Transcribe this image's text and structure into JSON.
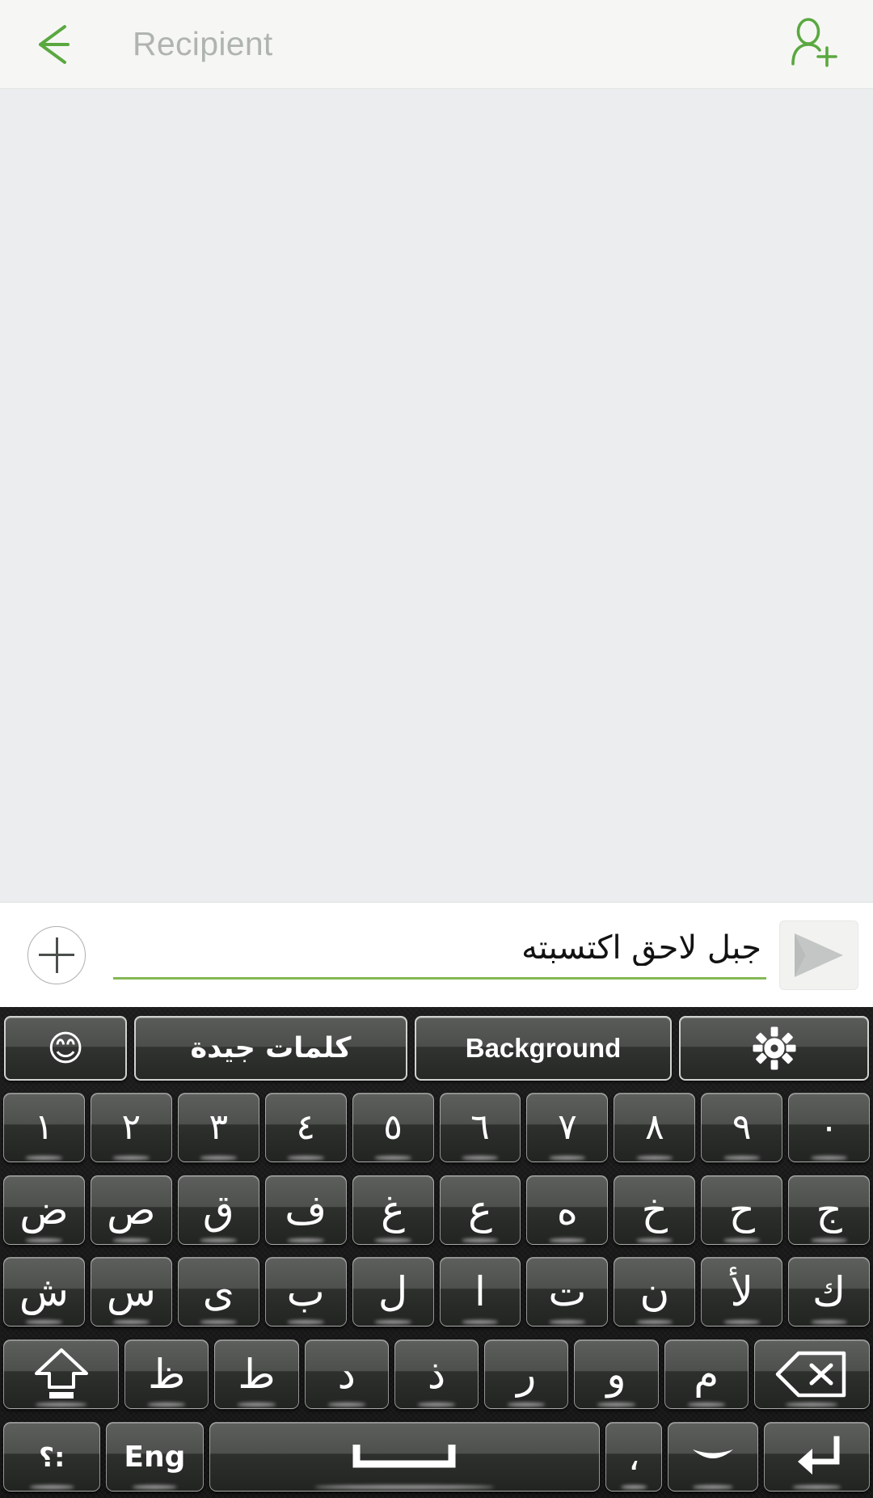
{
  "header": {
    "back_icon": "back-arrow-icon",
    "recipient_placeholder": "Recipient",
    "recipient_value": "",
    "add_contact_icon": "add-contact-icon",
    "accent_color": "#5aa840",
    "placeholder_color": "#b0b4b0",
    "background_color": "#f6f7f4"
  },
  "conversation": {
    "messages": [],
    "background_color": "#ebedee"
  },
  "compose": {
    "attach_icon": "plus-icon",
    "message_value": "جبل لاحق اكتسبته",
    "message_placeholder": "",
    "underline_color": "#84b854",
    "send_icon": "send-paper-plane-icon"
  },
  "keyboard": {
    "layout_name": "arabic",
    "toolbar": [
      {
        "name": "emoji-button",
        "label": "😊",
        "type": "emoji"
      },
      {
        "name": "good-words-button",
        "label": "كلمات جيدة",
        "type": "text"
      },
      {
        "name": "background-button",
        "label": "Background",
        "type": "text"
      },
      {
        "name": "settings-button",
        "label": "",
        "type": "gear"
      }
    ],
    "rows": [
      {
        "name": "number-row",
        "keys": [
          {
            "label": "١",
            "name": "key-1"
          },
          {
            "label": "٢",
            "name": "key-2"
          },
          {
            "label": "٣",
            "name": "key-3"
          },
          {
            "label": "٤",
            "name": "key-4"
          },
          {
            "label": "٥",
            "name": "key-5"
          },
          {
            "label": "٦",
            "name": "key-6"
          },
          {
            "label": "٧",
            "name": "key-7"
          },
          {
            "label": "٨",
            "name": "key-8"
          },
          {
            "label": "٩",
            "name": "key-9"
          },
          {
            "label": "٠",
            "name": "key-0"
          }
        ]
      },
      {
        "name": "letter-row-1",
        "keys": [
          {
            "label": "ض",
            "name": "key-dad"
          },
          {
            "label": "ص",
            "name": "key-sad"
          },
          {
            "label": "ق",
            "name": "key-qaf"
          },
          {
            "label": "ف",
            "name": "key-fa"
          },
          {
            "label": "غ",
            "name": "key-ghain"
          },
          {
            "label": "ع",
            "name": "key-ain"
          },
          {
            "label": "ه",
            "name": "key-ha"
          },
          {
            "label": "خ",
            "name": "key-kha"
          },
          {
            "label": "ح",
            "name": "key-hah"
          },
          {
            "label": "ج",
            "name": "key-jeem"
          }
        ]
      },
      {
        "name": "letter-row-2",
        "keys": [
          {
            "label": "ش",
            "name": "key-sheen"
          },
          {
            "label": "س",
            "name": "key-seen"
          },
          {
            "label": "ى",
            "name": "key-alef-maqsura"
          },
          {
            "label": "ب",
            "name": "key-ba"
          },
          {
            "label": "ل",
            "name": "key-lam"
          },
          {
            "label": "ا",
            "name": "key-alef"
          },
          {
            "label": "ت",
            "name": "key-ta"
          },
          {
            "label": "ن",
            "name": "key-noon"
          },
          {
            "label": "لأ",
            "name": "key-lam-alef-hamza"
          },
          {
            "label": "ك",
            "name": "key-kaf"
          }
        ]
      },
      {
        "name": "letter-row-3",
        "keys": [
          {
            "label": "",
            "name": "shift-key",
            "icon": "shift-arrow-icon"
          },
          {
            "label": "ظ",
            "name": "key-zah"
          },
          {
            "label": "ط",
            "name": "key-tah"
          },
          {
            "label": "د",
            "name": "key-dal"
          },
          {
            "label": "ذ",
            "name": "key-thal"
          },
          {
            "label": "ر",
            "name": "key-ra"
          },
          {
            "label": "و",
            "name": "key-waw"
          },
          {
            "label": "م",
            "name": "key-meem"
          },
          {
            "label": "",
            "name": "backspace-key",
            "icon": "backspace-icon"
          }
        ]
      },
      {
        "name": "bottom-row",
        "keys": [
          {
            "label": "؟:",
            "name": "symbols-key"
          },
          {
            "label": "Eng",
            "name": "language-switch-key"
          },
          {
            "label": "",
            "name": "space-key",
            "icon": "space-bar-icon"
          },
          {
            "label": "،",
            "name": "comma-key"
          },
          {
            "label": "",
            "name": "smiley-key",
            "icon": "smiley-key-icon"
          },
          {
            "label": "",
            "name": "enter-key",
            "icon": "enter-arrow-icon"
          }
        ]
      }
    ]
  }
}
